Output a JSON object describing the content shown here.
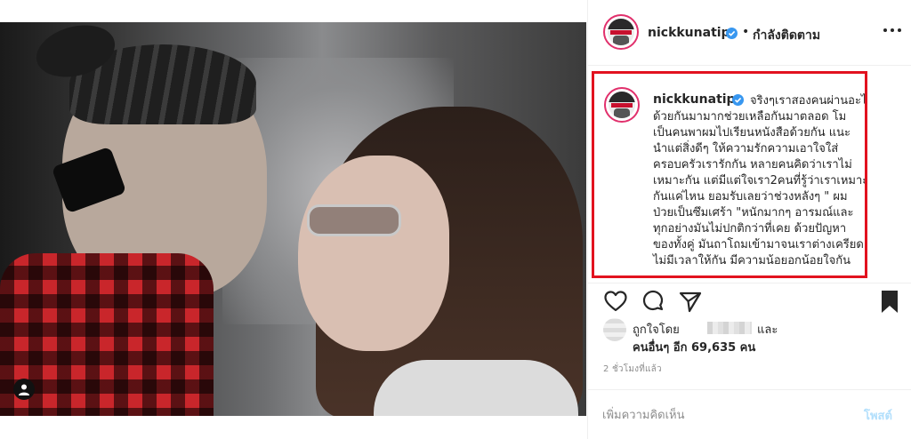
{
  "post": {
    "username": "nickkunatip",
    "dot": "•",
    "follow_status": "กำลังติดตาม",
    "caption": {
      "first_line": "จริงๆเราสองคนผ่านอะไร",
      "lines": [
        "ด้วยกันมามากช่วยเหลือกันมาตลอด โม",
        "เป็นคนพาผมไปเรียนหนังสือด้วยกัน แนะ",
        "นำแต่สิ่งดีๆ ให้ความรักความเอาใจใส่",
        "ครอบครัวเรารักกัน หลายคนคิดว่าเราไม่",
        "เหมาะกัน แต่มีแต่ใจเรา2คนที่รู้ว่าเราเหมาะ",
        "กันแค่ไหน ยอมรับเลยว่าช่วงหลังๆ \" ผม",
        "ป่วยเป็นซึมเศร้า \"หนักมากๆ อารมณ์และ",
        "ทุกอย่างมันไม่ปกติกว่าที่เคย ด้วยปัญหา",
        "ของทั้งคู่ มันถาโถมเข้ามาจนเราต่างเครียด",
        "ไม่มีเวลาให้กัน มีความน้อยอกน้อยใจกัน"
      ]
    },
    "likes": {
      "liked_by": "ถูกใจโดย",
      "and": "และ",
      "others": "คนอื่นๆ อีก 69,635 คน"
    },
    "timestamp": "2 ชั่วโมงที่แล้ว",
    "comment_placeholder": "เพิ่มความคิดเห็น",
    "post_label": "โพสต์"
  },
  "icons": {
    "more": "more-options-icon",
    "like": "heart-icon",
    "comment": "comment-icon",
    "share": "share-icon",
    "save": "bookmark-icon",
    "verified": "verified-badge-icon",
    "user_tag": "user-tag-icon"
  },
  "colors": {
    "highlight_border": "#e2121f",
    "verified_blue": "#3897f0",
    "story_ring": "#e1306c",
    "post_button_disabled": "#b2dffc"
  }
}
